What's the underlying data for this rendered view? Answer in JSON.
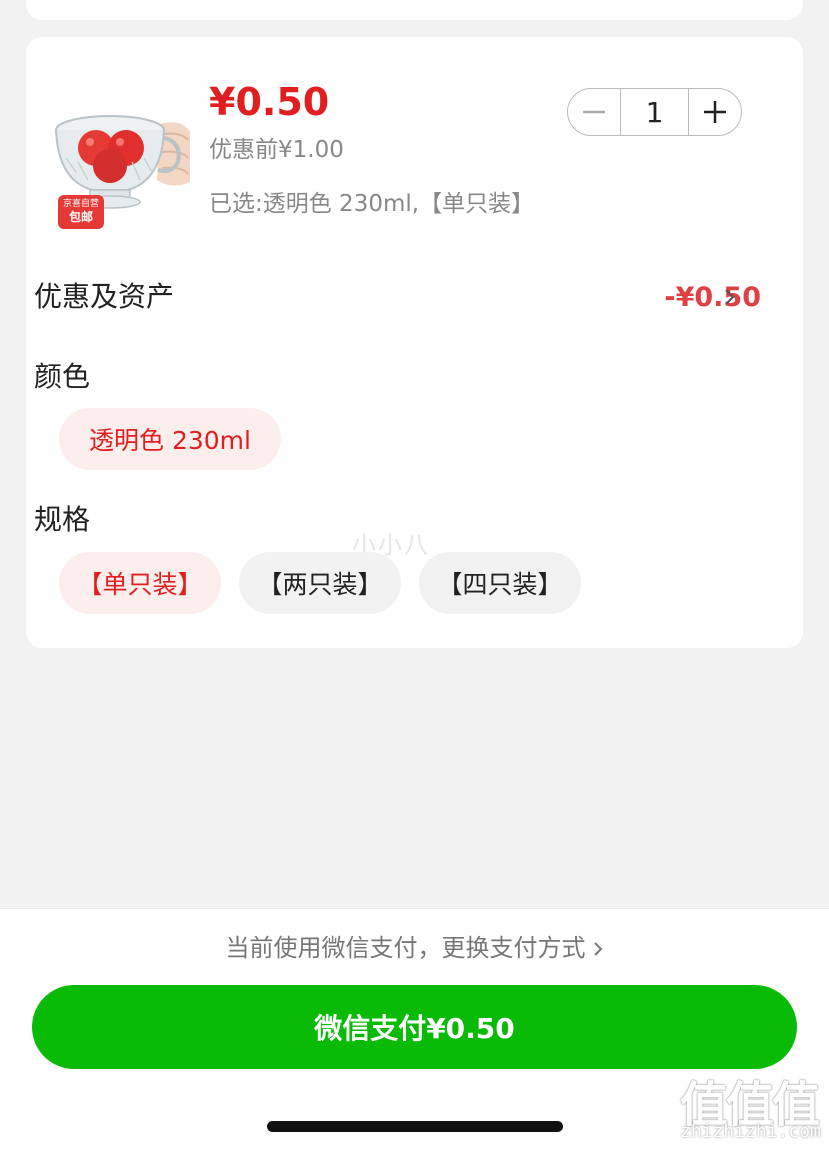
{
  "product": {
    "price": "¥0.50",
    "original_price": "优惠前¥1.00",
    "selected_spec": "已选:透明色 230ml,【单只装】",
    "badge_top": "京喜自营",
    "badge_bottom": "包邮",
    "quantity": "1"
  },
  "discount": {
    "label": "优惠及资产",
    "value": "-¥0.50"
  },
  "color_section": {
    "label": "颜色",
    "options": [
      "透明色 230ml"
    ],
    "selected": "透明色 230ml"
  },
  "spec_section": {
    "label": "规格",
    "options": [
      "【单只装】",
      "【两只装】",
      "【四只装】"
    ],
    "selected": "【单只装】"
  },
  "watermark": "小小八",
  "payment": {
    "switch_text": "当前使用微信支付，更换支付方式",
    "pay_button_label": "微信支付¥0.50"
  },
  "site_logo": {
    "mark": "值值值",
    "url": "zhizhizhi.com"
  },
  "colors": {
    "accent_red": "#e02020",
    "wechat_green": "#09bb07",
    "chip_active_bg": "#fdeeee"
  }
}
